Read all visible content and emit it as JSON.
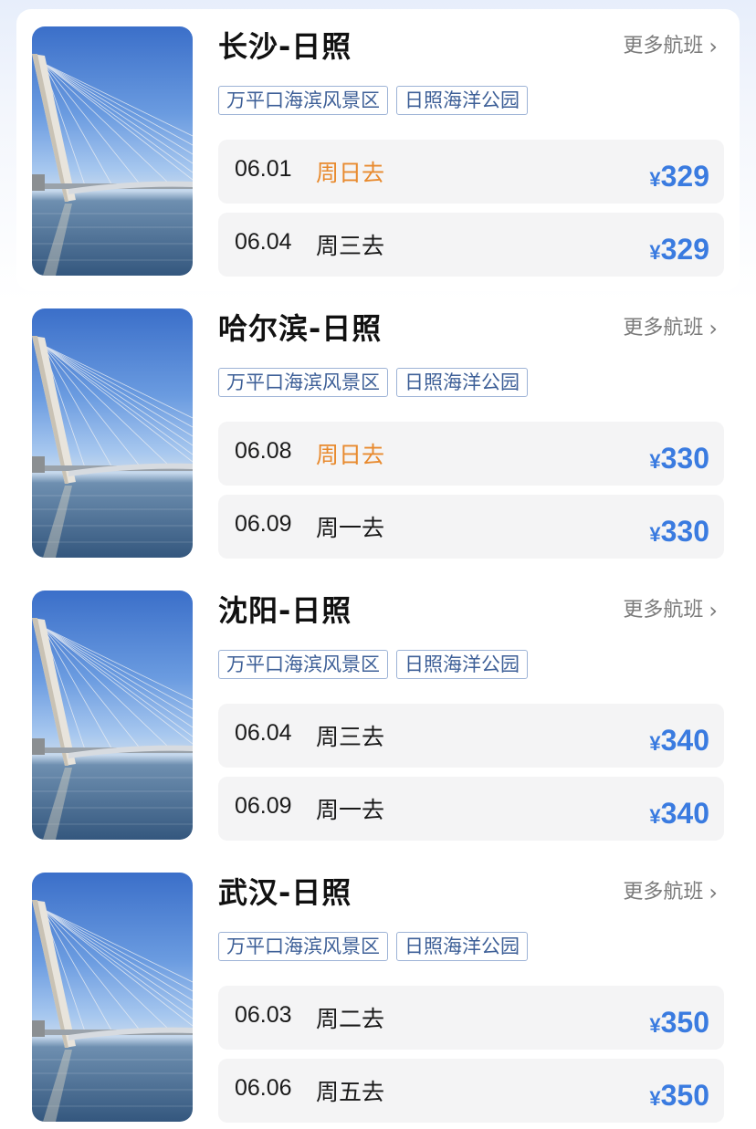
{
  "more_label": "更多航班",
  "more_icon": "chevron-right-icon",
  "currency": "¥",
  "colors": {
    "price": "#3a7be0",
    "weekday_highlight": "#e88a2e",
    "tag_border": "#9db3d6",
    "tag_text": "#3d5f97"
  },
  "routes": [
    {
      "title": "长沙-日照",
      "tags": [
        "万平口海滨风景区",
        "日照海洋公园"
      ],
      "flights": [
        {
          "date": "06.01",
          "weekday": "周日去",
          "price": "329",
          "highlight": true
        },
        {
          "date": "06.04",
          "weekday": "周三去",
          "price": "329",
          "highlight": false
        }
      ]
    },
    {
      "title": "哈尔滨-日照",
      "tags": [
        "万平口海滨风景区",
        "日照海洋公园"
      ],
      "flights": [
        {
          "date": "06.08",
          "weekday": "周日去",
          "price": "330",
          "highlight": true
        },
        {
          "date": "06.09",
          "weekday": "周一去",
          "price": "330",
          "highlight": false
        }
      ]
    },
    {
      "title": "沈阳-日照",
      "tags": [
        "万平口海滨风景区",
        "日照海洋公园"
      ],
      "flights": [
        {
          "date": "06.04",
          "weekday": "周三去",
          "price": "340",
          "highlight": false
        },
        {
          "date": "06.09",
          "weekday": "周一去",
          "price": "340",
          "highlight": false
        }
      ]
    },
    {
      "title": "武汉-日照",
      "tags": [
        "万平口海滨风景区",
        "日照海洋公园"
      ],
      "flights": [
        {
          "date": "06.03",
          "weekday": "周二去",
          "price": "350",
          "highlight": false
        },
        {
          "date": "06.06",
          "weekday": "周五去",
          "price": "350",
          "highlight": false
        }
      ]
    }
  ]
}
